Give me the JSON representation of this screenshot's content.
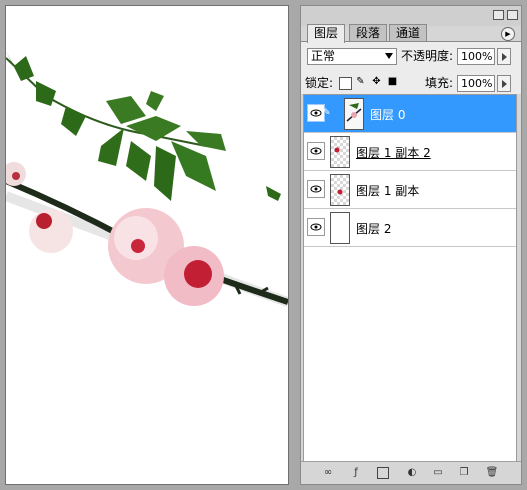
{
  "panel": {
    "tabs": [
      {
        "label": "图层"
      },
      {
        "label": "段落"
      },
      {
        "label": "通道"
      }
    ],
    "blend_mode": "正常",
    "opacity_label": "不透明度:",
    "opacity_value": "100%",
    "lock_label": "锁定:",
    "fill_label": "填充:",
    "fill_value": "100%"
  },
  "layers": [
    {
      "name": "图层 0",
      "selected": true,
      "thumbnail": "photo"
    },
    {
      "name": "图层 1 副本 2",
      "selected": false,
      "thumbnail": "transparent"
    },
    {
      "name": "图层 1 副本",
      "selected": false,
      "thumbnail": "transparent"
    },
    {
      "name": "图层 2",
      "selected": false,
      "thumbnail": "white"
    }
  ],
  "footer_icons": [
    "link-icon",
    "fx-icon",
    "mask-icon",
    "adjustment-icon",
    "folder-icon",
    "new-layer-icon",
    "trash-icon"
  ],
  "colors": {
    "selection": "#3399ff",
    "panel_bg": "#d6d6d6",
    "workspace": "#a8a8a8"
  }
}
